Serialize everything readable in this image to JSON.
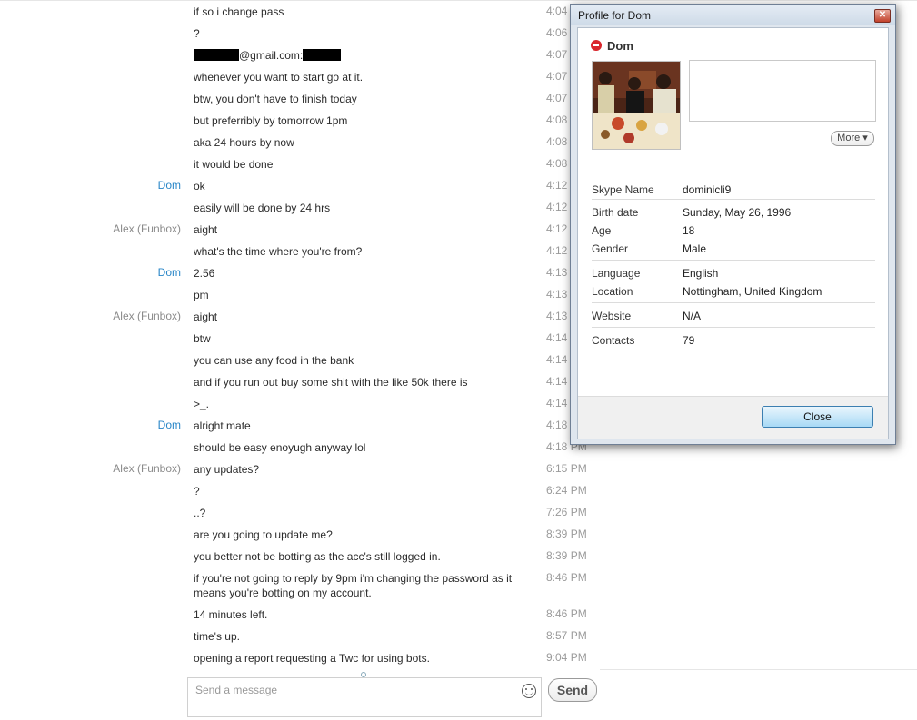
{
  "chat": {
    "rows": [
      {
        "sender": "",
        "sender_type": "",
        "text": "if so i change pass",
        "time": "4:04"
      },
      {
        "sender": "",
        "sender_type": "",
        "text": "?",
        "time": "4:06"
      },
      {
        "sender": "",
        "sender_type": "",
        "text": "@gmail.com:",
        "time": "4:07",
        "redacted": true
      },
      {
        "sender": "",
        "sender_type": "",
        "text": "whenever you want to start go  at it.",
        "time": "4:07"
      },
      {
        "sender": "",
        "sender_type": "",
        "text": "btw, you don't have to finish today",
        "time": "4:07"
      },
      {
        "sender": "",
        "sender_type": "",
        "text": "but preferribly by tomorrow 1pm",
        "time": "4:08"
      },
      {
        "sender": "",
        "sender_type": "",
        "text": "aka 24 hours by now",
        "time": "4:08"
      },
      {
        "sender": "",
        "sender_type": "",
        "text": "it would be done",
        "time": "4:08"
      },
      {
        "sender": "Dom",
        "sender_type": "dom",
        "text": "ok",
        "time": "4:12"
      },
      {
        "sender": "",
        "sender_type": "",
        "text": "easily will be done by 24 hrs",
        "time": "4:12"
      },
      {
        "sender": "Alex (Funbox)",
        "sender_type": "alex",
        "text": "aight",
        "time": "4:12"
      },
      {
        "sender": "",
        "sender_type": "",
        "text": "what's the time where you're from?",
        "time": "4:12"
      },
      {
        "sender": "Dom",
        "sender_type": "dom",
        "text": "2.56",
        "time": "4:13"
      },
      {
        "sender": "",
        "sender_type": "",
        "text": "pm",
        "time": "4:13"
      },
      {
        "sender": "Alex (Funbox)",
        "sender_type": "alex",
        "text": "aight",
        "time": "4:13"
      },
      {
        "sender": "",
        "sender_type": "",
        "text": "btw",
        "time": "4:14"
      },
      {
        "sender": "",
        "sender_type": "",
        "text": "you can use any food in the bank",
        "time": "4:14"
      },
      {
        "sender": "",
        "sender_type": "",
        "text": "and if you run out buy some shit with the like 50k there is",
        "time": "4:14"
      },
      {
        "sender": "",
        "sender_type": "",
        "text": ">_.",
        "time": "4:14"
      },
      {
        "sender": "Dom",
        "sender_type": "dom",
        "text": "alright mate",
        "time": "4:18"
      },
      {
        "sender": "",
        "sender_type": "",
        "text": "should be easy enoyugh anyway lol",
        "time": "4:18 PM"
      },
      {
        "sender": "Alex (Funbox)",
        "sender_type": "alex",
        "text": "any updates?",
        "time": "6:15 PM"
      },
      {
        "sender": "",
        "sender_type": "",
        "text": "?",
        "time": "6:24 PM"
      },
      {
        "sender": "",
        "sender_type": "",
        "text": "..?",
        "time": "7:26 PM"
      },
      {
        "sender": "",
        "sender_type": "",
        "text": "are you going to update me?",
        "time": "8:39 PM"
      },
      {
        "sender": "",
        "sender_type": "",
        "text": "you better not be botting as the acc's still logged in.",
        "time": "8:39 PM"
      },
      {
        "sender": "",
        "sender_type": "",
        "text": "if you're not going to reply by 9pm i'm changing the password as it means you're botting on my account.",
        "time": "8:46 PM"
      },
      {
        "sender": "",
        "sender_type": "",
        "text": "14 minutes left.",
        "time": "8:46 PM"
      },
      {
        "sender": "",
        "sender_type": "",
        "text": "time's up.",
        "time": "8:57 PM"
      },
      {
        "sender": "",
        "sender_type": "",
        "text": "opening a report requesting a Twc for using bots.",
        "time": "9:04 PM"
      }
    ]
  },
  "composer": {
    "placeholder": "Send a message",
    "emoji_icon": "smiley-icon",
    "send_label": "Send"
  },
  "profile": {
    "title": "Profile for Dom",
    "name": "Dom",
    "status_icon": "busy-status-icon",
    "more_label": "More",
    "fields": {
      "skype_name": {
        "label": "Skype Name",
        "value": "dominicli9"
      },
      "birth_date": {
        "label": "Birth date",
        "value": "Sunday, May 26, 1996"
      },
      "age": {
        "label": "Age",
        "value": "18"
      },
      "gender": {
        "label": "Gender",
        "value": "Male"
      },
      "language": {
        "label": "Language",
        "value": "English"
      },
      "location": {
        "label": "Location",
        "value": "Nottingham, United Kingdom"
      },
      "website": {
        "label": "Website",
        "value": "N/A"
      },
      "contacts": {
        "label": "Contacts",
        "value": "79"
      }
    },
    "close_label": "Close"
  },
  "colors": {
    "dom_sender": "#2a87c8",
    "alex_sender": "#8a8a8a",
    "busy_status": "#d9262c"
  }
}
